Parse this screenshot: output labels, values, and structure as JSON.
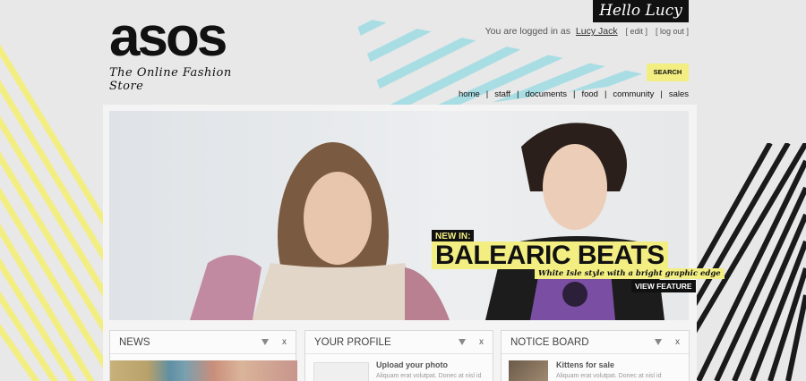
{
  "header": {
    "logo_text": "asos",
    "tagline": "The Online Fashion Store",
    "greeting": "Hello Lucy",
    "login_prefix": "You are logged in as",
    "username": "Lucy Jack",
    "edit_label": "[ edit ]",
    "logout_label": "[ log out ]",
    "search_label": "SEARCH"
  },
  "nav": {
    "items": [
      "home",
      "staff",
      "documents",
      "food",
      "community",
      "sales"
    ],
    "separator": "|"
  },
  "hero": {
    "tag": "NEW IN:",
    "title": "BALEARIC BEATS",
    "subtitle": "White Isle style with a bright graphic edge",
    "cta": "VIEW FEATURE"
  },
  "boxes": {
    "news": {
      "title": "NEWS",
      "close": "x"
    },
    "profile": {
      "title": "YOUR PROFILE",
      "close": "x",
      "item_title": "Upload your photo",
      "item_text": "Aliquam erat volutpat. Donec at nisl id"
    },
    "notice": {
      "title": "NOTICE BOARD",
      "close": "x",
      "item_title": "Kittens for sale",
      "item_text": "Aliquam erat volutpat. Donec at nisl id"
    }
  },
  "colors": {
    "accent_yellow": "#f2ee82",
    "stripe_blue": "#a9dde4",
    "dark": "#111111"
  }
}
